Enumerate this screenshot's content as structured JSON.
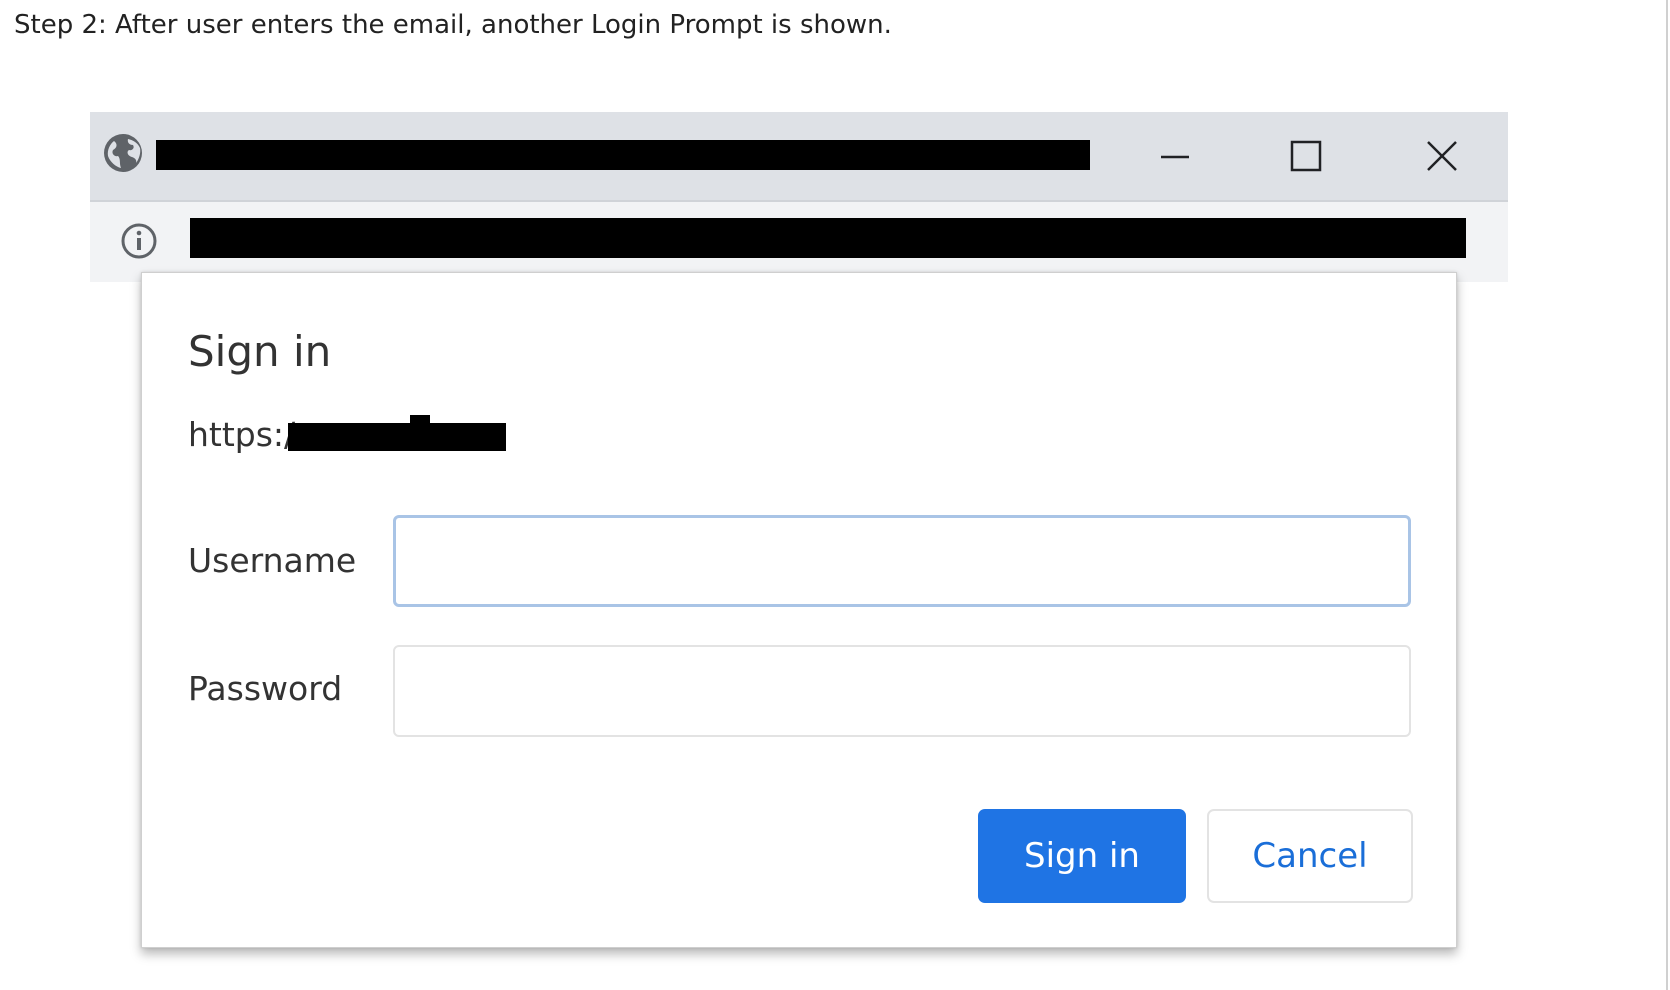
{
  "caption": "Step 2: After user enters the email, another Login Prompt is shown.",
  "browser": {
    "title_icon": "globe-icon",
    "address_icon": "info-icon",
    "controls": {
      "minimize_icon": "minimize-icon",
      "maximize_icon": "maximize-icon",
      "close_icon": "close-icon"
    }
  },
  "dialog": {
    "title": "Sign in",
    "origin_prefix": "https:/",
    "username_label": "Username",
    "username_value": "",
    "password_label": "Password",
    "password_value": "",
    "signin_button": "Sign in",
    "cancel_button": "Cancel"
  },
  "colors": {
    "primary_button": "#1f74e4",
    "cancel_text": "#1a6ed8",
    "focused_border": "#a9c4e6",
    "browser_chrome": "#dee1e6"
  }
}
